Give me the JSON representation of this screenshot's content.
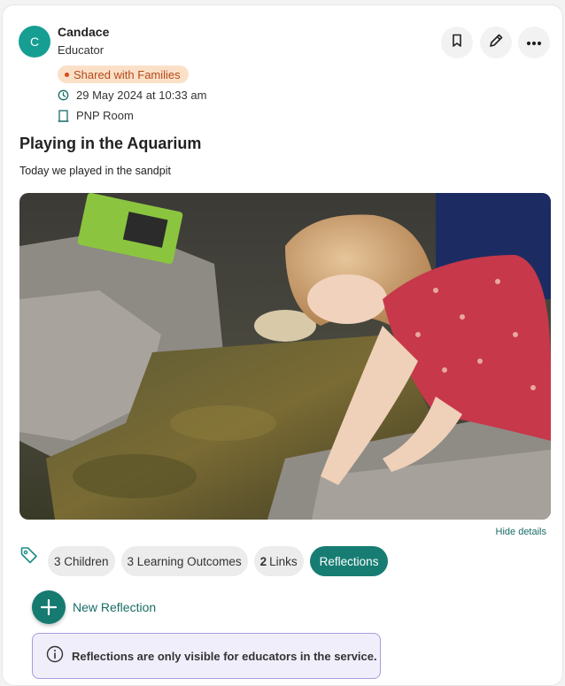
{
  "post": {
    "author_initial": "C",
    "author_name": "Candace",
    "author_role": "Educator",
    "share_status": "Shared with Families",
    "timestamp": "29 May 2024 at 10:33 am",
    "room": "PNP Room",
    "title": "Playing in the Aquarium",
    "description": "Today we played in the sandpit",
    "photo_icon": "photo-child-aquarium",
    "hide_details_label": "Hide details"
  },
  "actions": {
    "icons": [
      "bookmark-icon",
      "edit-pencil-icon",
      "more-dots-icon"
    ]
  },
  "chips": {
    "tag_icon": "tag-icon",
    "children": "3 Children",
    "learning_outcomes": "3 Learning Outcomes",
    "links_count": "2",
    "links_label": "Links",
    "reflections": "Reflections"
  },
  "reflection": {
    "new_label": "New Reflection",
    "notice": "Reflections are only visible for educators in the service."
  },
  "colors": {
    "accent": "#177d73",
    "avatar": "#179e93",
    "badge_bg": "#fbe0c8",
    "badge_text": "#b34a1a",
    "notice_bg": "#f1eefc",
    "notice_border": "#a99be0"
  }
}
